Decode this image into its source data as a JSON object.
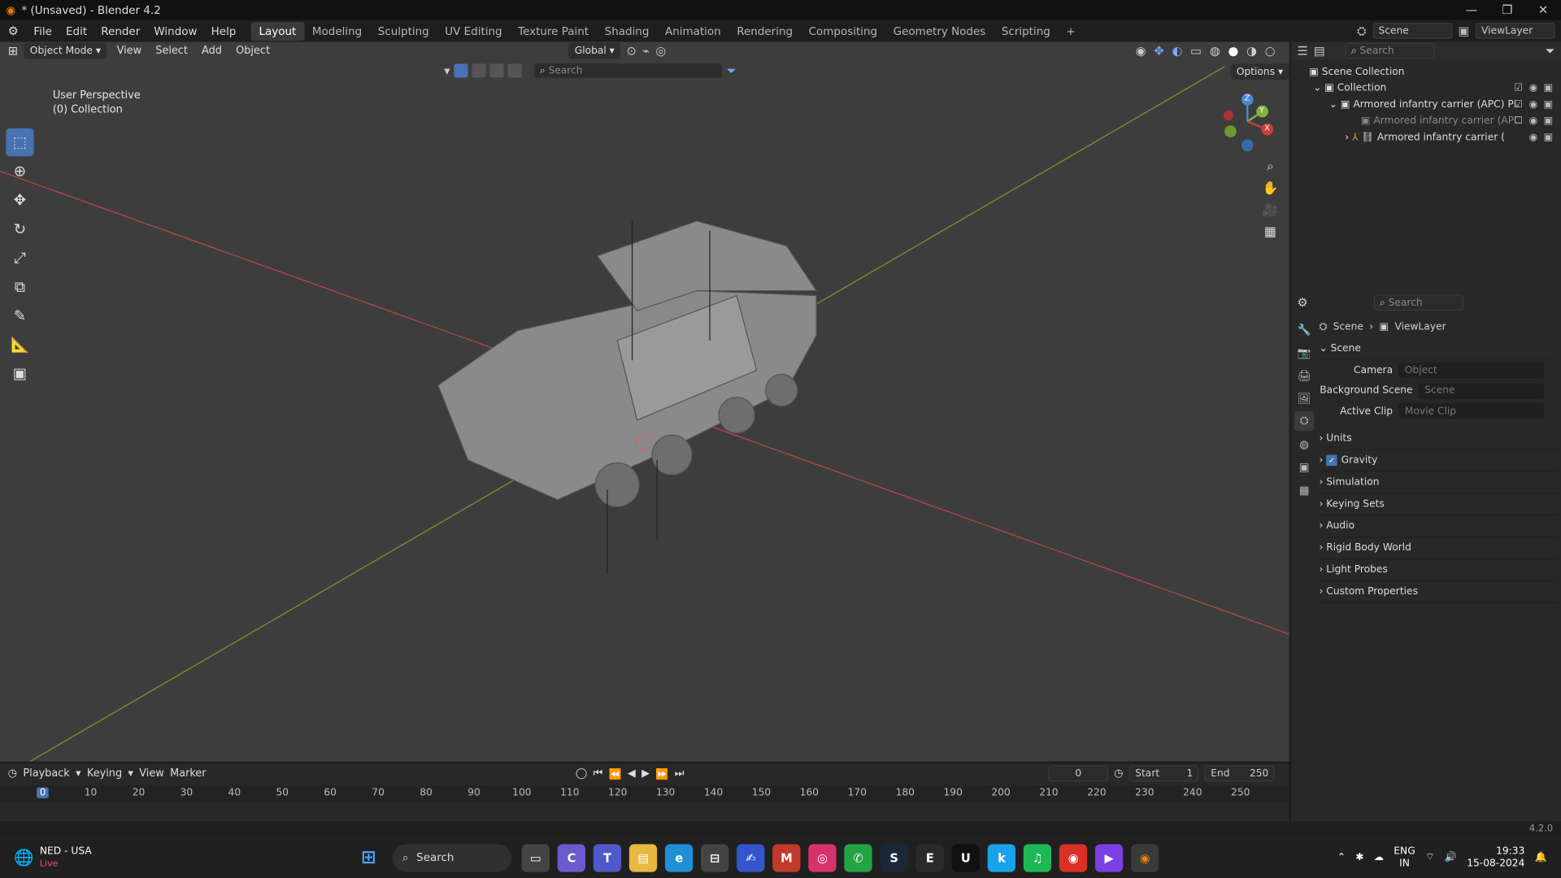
{
  "window": {
    "title": "* (Unsaved) - Blender 4.2"
  },
  "menu": [
    "File",
    "Edit",
    "Render",
    "Window",
    "Help"
  ],
  "workspaces": [
    "Layout",
    "Modeling",
    "Sculpting",
    "UV Editing",
    "Texture Paint",
    "Shading",
    "Animation",
    "Rendering",
    "Compositing",
    "Geometry Nodes",
    "Scripting"
  ],
  "active_workspace": "Layout",
  "scene_selector": {
    "scene": "Scene",
    "view_layer": "ViewLayer"
  },
  "viewport_header": {
    "mode": "Object Mode",
    "menus": [
      "View",
      "Select",
      "Add",
      "Object"
    ],
    "orientation": "Global",
    "search_placeholder": "Search",
    "options": "Options"
  },
  "viewport_overlay": {
    "perspective": "User Perspective",
    "collection": "(0) Collection"
  },
  "gizmo_axes": {
    "z": "Z",
    "y": "Y",
    "x": "X"
  },
  "outliner": {
    "search_placeholder": "Search",
    "items": [
      {
        "label": "Scene Collection",
        "indent": 0
      },
      {
        "label": "Collection",
        "indent": 1
      },
      {
        "label": "Armored infantry carrier (APC) PL",
        "indent": 2
      },
      {
        "label": "Armored infantry carrier (APC",
        "indent": 3
      },
      {
        "label": "Armored infantry carrier (",
        "indent": 3
      }
    ]
  },
  "properties": {
    "search_placeholder": "Search",
    "breadcrumb": {
      "scene": "Scene",
      "view_layer": "ViewLayer"
    },
    "section": "Scene",
    "fields": [
      {
        "label": "Camera",
        "placeholder": "Object"
      },
      {
        "label": "Background Scene",
        "placeholder": "Scene"
      },
      {
        "label": "Active Clip",
        "placeholder": "Movie Clip"
      }
    ],
    "panels": [
      "Units",
      "Gravity",
      "Simulation",
      "Keying Sets",
      "Audio",
      "Rigid Body World",
      "Light Probes",
      "Custom Properties"
    ],
    "gravity_checked": true
  },
  "timeline": {
    "menus": [
      "Playback",
      "Keying",
      "View",
      "Marker"
    ],
    "current_frame": "0",
    "start_label": "Start",
    "start": "1",
    "end_label": "End",
    "end": "250",
    "ticks": [
      "0",
      "10",
      "20",
      "30",
      "40",
      "50",
      "60",
      "70",
      "80",
      "90",
      "100",
      "110",
      "120",
      "130",
      "140",
      "150",
      "160",
      "170",
      "180",
      "190",
      "200",
      "210",
      "220",
      "230",
      "240",
      "250"
    ]
  },
  "statusbar": {
    "version": "4.2.0"
  },
  "taskbar": {
    "weather_title": "NED - USA",
    "weather_sub": "Live",
    "search": "Search",
    "lang": "ENG",
    "region": "IN",
    "time": "19:33",
    "date": "15-08-2024"
  },
  "colors": {
    "accent": "#4772b3",
    "x_axis": "#c8413d",
    "y_axis": "#82b43c",
    "z_axis": "#4a87d6"
  }
}
